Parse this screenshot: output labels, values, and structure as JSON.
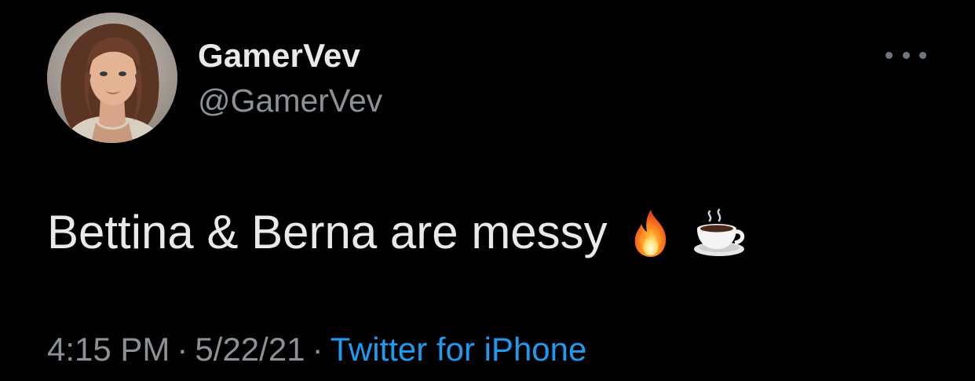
{
  "author": {
    "display_name": "GamerVev",
    "handle": "@GamerVev",
    "avatar_icon": "profile-photo"
  },
  "more_icon": "ellipsis-icon",
  "tweet": {
    "text": "Bettina & Berna are messy",
    "emojis": [
      "fire-emoji",
      "hot-beverage-emoji"
    ]
  },
  "meta": {
    "time": "4:15 PM",
    "separator": "·",
    "date": "5/22/21",
    "source": "Twitter for iPhone"
  },
  "colors": {
    "background": "#000000",
    "primary_text": "#e7e9ea",
    "secondary_text": "#8b9196",
    "link": "#1d9bf0"
  }
}
